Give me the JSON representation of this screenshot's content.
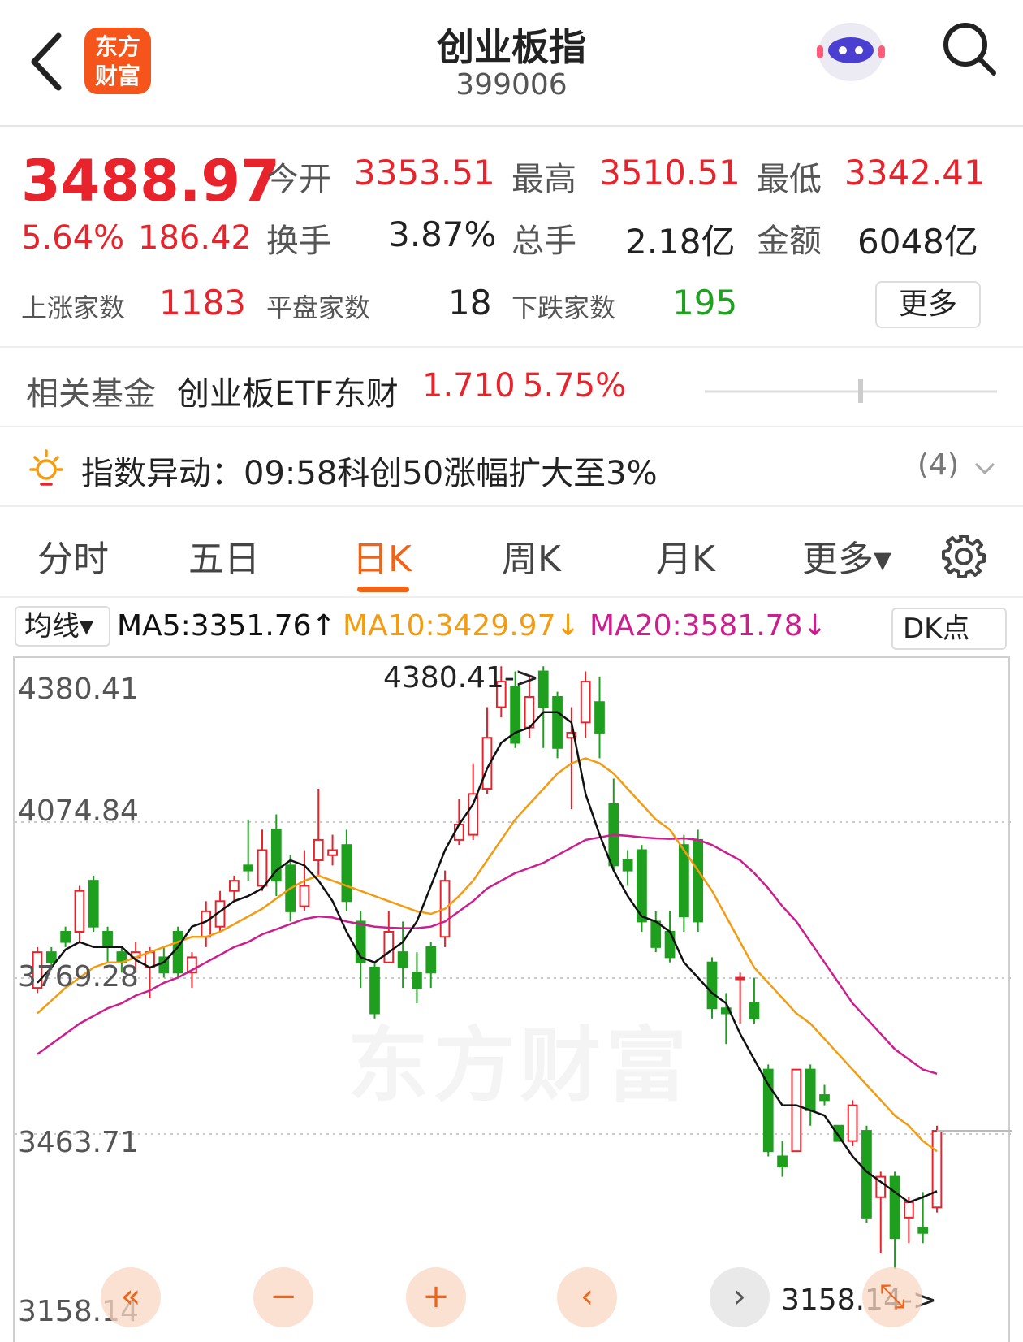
{
  "header": {
    "title": "创业板指",
    "code": "399006",
    "logo_line1": "东方",
    "logo_line2": "财富"
  },
  "quote": {
    "price": "3488.97",
    "change_pct": "5.64%",
    "change_abs": "186.42",
    "open_label": "今开",
    "open": "3353.51",
    "high_label": "最高",
    "high": "3510.51",
    "low_label": "最低",
    "low": "3342.41",
    "turnover_label": "换手",
    "turnover": "3.87%",
    "volume_label": "总手",
    "volume": "2.18亿",
    "amount_label": "金额",
    "amount": "6048亿",
    "up_label": "上涨家数",
    "up": "1183",
    "flat_label": "平盘家数",
    "flat": "18",
    "down_label": "下跌家数",
    "down": "195",
    "more": "更多"
  },
  "fund": {
    "label": "相关基金",
    "name": "创业板ETF东财",
    "price": "1.710",
    "pct": "5.75%"
  },
  "alert": {
    "label": "指数异动：",
    "text": "09:58科创50涨幅扩大至3%",
    "count": "(4)"
  },
  "tabs": [
    "分时",
    "五日",
    "日K",
    "周K",
    "月K",
    "更多▾"
  ],
  "active_tab": "日K",
  "ma": {
    "select": "均线▾",
    "ma5": "MA5:3351.76↑",
    "ma10": "MA10:3429.97↓",
    "ma20": "MA20:3581.78↓",
    "dk": "DK点"
  },
  "colors": {
    "up": "#e8232c",
    "down": "#1ea01e",
    "ma5": "#111111",
    "ma10": "#f39c12",
    "ma20": "#cc1f8f",
    "accent": "#f06418"
  },
  "chart_data": {
    "type": "candlestick",
    "y_ticks": [
      "4380.41",
      "4074.84",
      "3769.28",
      "3463.71",
      "3158.14"
    ],
    "ylim": [
      3158.14,
      4380.41
    ],
    "high_marker": "4380.41->",
    "low_marker": "3158.14->",
    "watermark": "东方财富",
    "candles": [
      [
        3750,
        3820,
        3740,
        3830
      ],
      [
        3820,
        3800,
        3785,
        3830
      ],
      [
        3860,
        3840,
        3830,
        3870
      ],
      [
        3860,
        3940,
        3840,
        3950
      ],
      [
        3960,
        3870,
        3860,
        3970
      ],
      [
        3860,
        3830,
        3800,
        3870
      ],
      [
        3820,
        3800,
        3780,
        3830
      ],
      [
        3810,
        3820,
        3780,
        3840
      ],
      [
        3790,
        3820,
        3730,
        3830
      ],
      [
        3810,
        3780,
        3770,
        3830
      ],
      [
        3860,
        3780,
        3770,
        3870
      ],
      [
        3780,
        3810,
        3750,
        3820
      ],
      [
        3850,
        3900,
        3830,
        3920
      ],
      [
        3870,
        3920,
        3860,
        3940
      ],
      [
        3940,
        3960,
        3920,
        3970
      ],
      [
        3990,
        3980,
        3960,
        4080
      ],
      [
        3950,
        4020,
        3940,
        4060
      ],
      [
        4060,
        3960,
        3930,
        4090
      ],
      [
        3990,
        3900,
        3880,
        4010
      ],
      [
        3910,
        3950,
        3900,
        4020
      ],
      [
        4000,
        4040,
        3970,
        4140
      ],
      [
        4010,
        4020,
        3990,
        4050
      ],
      [
        4030,
        3920,
        3900,
        4060
      ],
      [
        3880,
        3800,
        3750,
        3900
      ],
      [
        3790,
        3700,
        3690,
        3800
      ],
      [
        3800,
        3860,
        3800,
        3900
      ],
      [
        3820,
        3790,
        3750,
        3880
      ],
      [
        3780,
        3750,
        3720,
        3820
      ],
      [
        3830,
        3780,
        3750,
        3840
      ],
      [
        3850,
        3960,
        3830,
        3980
      ],
      [
        4040,
        4070,
        4030,
        4120
      ],
      [
        4050,
        4130,
        4040,
        4190
      ],
      [
        4140,
        4240,
        4130,
        4300
      ],
      [
        4300,
        4350,
        4280,
        4380
      ],
      [
        4340,
        4230,
        4220,
        4370
      ],
      [
        4260,
        4320,
        4240,
        4360
      ],
      [
        4370,
        4300,
        4220,
        4380
      ],
      [
        4320,
        4220,
        4200,
        4330
      ],
      [
        4240,
        4250,
        4100,
        4300
      ],
      [
        4270,
        4350,
        4240,
        4370
      ],
      [
        4310,
        4250,
        4200,
        4360
      ],
      [
        4110,
        3990,
        3980,
        4160
      ],
      [
        4000,
        3980,
        3950,
        4020
      ],
      [
        4020,
        3880,
        3860,
        4030
      ],
      [
        3880,
        3830,
        3820,
        3900
      ],
      [
        3860,
        3810,
        3800,
        3900
      ],
      [
        4030,
        3890,
        3860,
        4050
      ],
      [
        4040,
        3880,
        3860,
        4060
      ],
      [
        3800,
        3710,
        3690,
        3810
      ],
      [
        3710,
        3700,
        3640,
        3740
      ],
      [
        3770,
        3770,
        3680,
        3780
      ],
      [
        3720,
        3690,
        3680,
        3770
      ],
      [
        3590,
        3430,
        3420,
        3600
      ],
      [
        3420,
        3400,
        3380,
        3450
      ],
      [
        3430,
        3590,
        3450,
        3590
      ],
      [
        3590,
        3510,
        3480,
        3600
      ],
      [
        3540,
        3530,
        3520,
        3560
      ],
      [
        3480,
        3450,
        3450,
        3470
      ],
      [
        3450,
        3520,
        3440,
        3530
      ],
      [
        3470,
        3300,
        3290,
        3480
      ],
      [
        3340,
        3380,
        3230,
        3390
      ],
      [
        3380,
        3260,
        3200,
        3390
      ],
      [
        3300,
        3330,
        3250,
        3340
      ],
      [
        3280,
        3270,
        3250,
        3350
      ],
      [
        3320,
        3470,
        3310,
        3480
      ]
    ],
    "ma5": [
      3760,
      3790,
      3825,
      3840,
      3830,
      3830,
      3830,
      3805,
      3790,
      3800,
      3830,
      3870,
      3880,
      3900,
      3920,
      3930,
      3945,
      3980,
      4000,
      3990,
      3960,
      3920,
      3860,
      3810,
      3800,
      3820,
      3840,
      3880,
      3950,
      4020,
      4070,
      4110,
      4180,
      4230,
      4250,
      4260,
      4290,
      4290,
      4270,
      4130,
      4050,
      3980,
      3930,
      3890,
      3880,
      3860,
      3800,
      3770,
      3740,
      3720,
      3660,
      3610,
      3560,
      3520,
      3520,
      3510,
      3500,
      3460,
      3420,
      3390,
      3370,
      3350,
      3330,
      3340,
      3351.76
    ],
    "ma10": [
      3700,
      3725,
      3750,
      3770,
      3790,
      3800,
      3800,
      3810,
      3820,
      3830,
      3840,
      3850,
      3850,
      3860,
      3875,
      3890,
      3905,
      3925,
      3945,
      3960,
      3970,
      3960,
      3950,
      3940,
      3930,
      3920,
      3910,
      3900,
      3895,
      3905,
      3930,
      3960,
      4000,
      4040,
      4080,
      4110,
      4140,
      4170,
      4190,
      4200,
      4190,
      4170,
      4140,
      4110,
      4080,
      4060,
      4020,
      3980,
      3940,
      3890,
      3840,
      3790,
      3760,
      3730,
      3700,
      3680,
      3650,
      3620,
      3590,
      3560,
      3530,
      3500,
      3480,
      3450,
      3429.97
    ],
    "ma20": [
      3620,
      3640,
      3660,
      3680,
      3695,
      3710,
      3720,
      3735,
      3745,
      3760,
      3770,
      3785,
      3800,
      3815,
      3830,
      3840,
      3855,
      3865,
      3875,
      3885,
      3890,
      3888,
      3880,
      3875,
      3870,
      3868,
      3867,
      3867,
      3870,
      3880,
      3900,
      3920,
      3945,
      3960,
      3975,
      3985,
      3995,
      4010,
      4025,
      4040,
      4045,
      4050,
      4048,
      4045,
      4043,
      4042,
      4043,
      4040,
      4030,
      4015,
      4000,
      3975,
      3945,
      3910,
      3880,
      3840,
      3800,
      3760,
      3720,
      3690,
      3660,
      3630,
      3610,
      3590,
      3581.78
    ]
  }
}
